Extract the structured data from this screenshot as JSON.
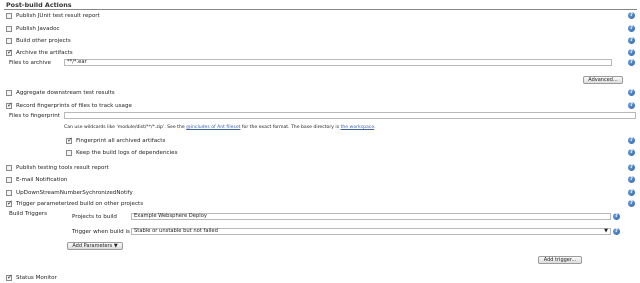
{
  "section_title": "Post-build Actions",
  "options": {
    "junit": {
      "label": "Publish JUnit test result report",
      "checked": false
    },
    "javadoc": {
      "label": "Publish Javadoc",
      "checked": false
    },
    "build_other": {
      "label": "Build other projects",
      "checked": false
    },
    "archive": {
      "label": "Archive the artifacts",
      "checked": true
    },
    "aggregate": {
      "label": "Aggregate downstream test results",
      "checked": false
    },
    "fingerprints": {
      "label": "Record fingerprints of files to track usage",
      "checked": true
    },
    "testing_tools": {
      "label": "Publish testing tools result report",
      "checked": false
    },
    "email": {
      "label": "E-mail Notification",
      "checked": false
    },
    "updown": {
      "label": "UpDownStreamNumberSychronizedNotify",
      "checked": false
    },
    "trigger_param": {
      "label": "Trigger parameterized build on other projects",
      "checked": true
    },
    "status_monitor": {
      "label": "Status Monitor",
      "checked": true
    }
  },
  "archive": {
    "files_label": "Files to archive",
    "files_value": "**/*.ear",
    "advanced_button": "Advanced..."
  },
  "fingerprint": {
    "files_label": "Files to fingerprint",
    "files_value": "",
    "hint_prefix": "Can use wildcards like 'module/dist/**/*.zip'. See the ",
    "hint_link1": "@includes of Ant fileset",
    "hint_mid": " for the exact format. The base directory is ",
    "hint_link2": "the workspace",
    "hint_suffix": ".",
    "all_archived": {
      "label": "Fingerprint all archived artifacts",
      "checked": true
    },
    "keep_logs": {
      "label": "Keep the build logs of dependencies",
      "checked": false
    }
  },
  "build_triggers": {
    "label": "Build Triggers",
    "projects_label": "Projects to build",
    "projects_value": "Example Websphere Deploy",
    "trigger_when_label": "Trigger when build is",
    "trigger_when_value": "Stable or unstable but not failed",
    "add_parameters": "Add Parameters",
    "add_trigger": "Add trigger..."
  },
  "help_glyph": "?",
  "icons": {
    "help": "help-icon",
    "check": "check-icon",
    "dropdown": "chevron-down-icon"
  }
}
